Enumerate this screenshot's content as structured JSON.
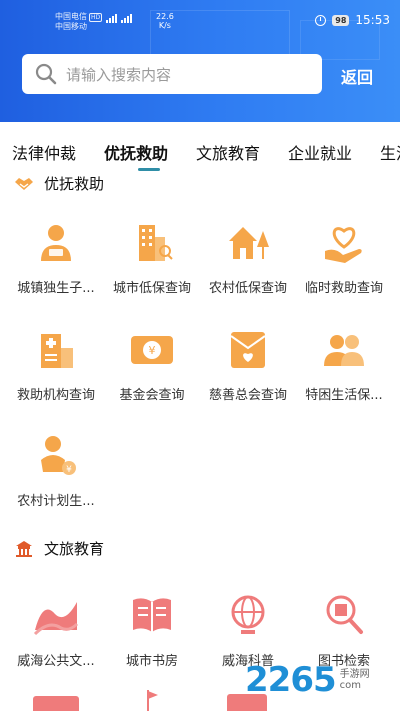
{
  "status_bar": {
    "carrier1": "中国电信",
    "carrier2": "中国移动",
    "hd": "HD",
    "net_speed": "22.6",
    "net_unit": "K/s",
    "battery": "98",
    "time": "15:53"
  },
  "search": {
    "placeholder": "请输入搜索内容"
  },
  "header": {
    "back_label": "返回"
  },
  "tabs": [
    {
      "label": "法律仲裁"
    },
    {
      "label": "优抚救助"
    },
    {
      "label": "文旅教育"
    },
    {
      "label": "企业就业"
    },
    {
      "label": "生活"
    }
  ],
  "sections": {
    "youfu": {
      "title": "优抚救助",
      "items": [
        {
          "label": "城镇独生子...",
          "icon": "elder-subsidy-icon"
        },
        {
          "label": "城市低保查询",
          "icon": "city-building-icon"
        },
        {
          "label": "农村低保查询",
          "icon": "village-house-icon"
        },
        {
          "label": "临时救助查询",
          "icon": "heart-hand-icon"
        },
        {
          "label": "救助机构查询",
          "icon": "hospital-icon"
        },
        {
          "label": "基金会查询",
          "icon": "yuan-card-icon"
        },
        {
          "label": "慈善总会查询",
          "icon": "charity-envelope-icon"
        },
        {
          "label": "特困生活保...",
          "icon": "people-group-icon"
        },
        {
          "label": "农村计划生...",
          "icon": "baby-icon"
        }
      ]
    },
    "wenlv": {
      "title": "文旅教育",
      "items": [
        {
          "label": "威海公共文...",
          "icon": "culture-wave-icon"
        },
        {
          "label": "城市书房",
          "icon": "book-icon"
        },
        {
          "label": "威海科普",
          "icon": "globe-icon"
        },
        {
          "label": "图书检索",
          "icon": "book-search-icon"
        }
      ]
    }
  },
  "watermark": {
    "number": "2265",
    "dot": ".",
    "suffix": "com",
    "text": "手游网"
  },
  "colors": {
    "header_blue": "#2f7cf2",
    "orange": "#f5a64a",
    "red": "#ef7b7b",
    "indicator": "#2f8ea7"
  }
}
